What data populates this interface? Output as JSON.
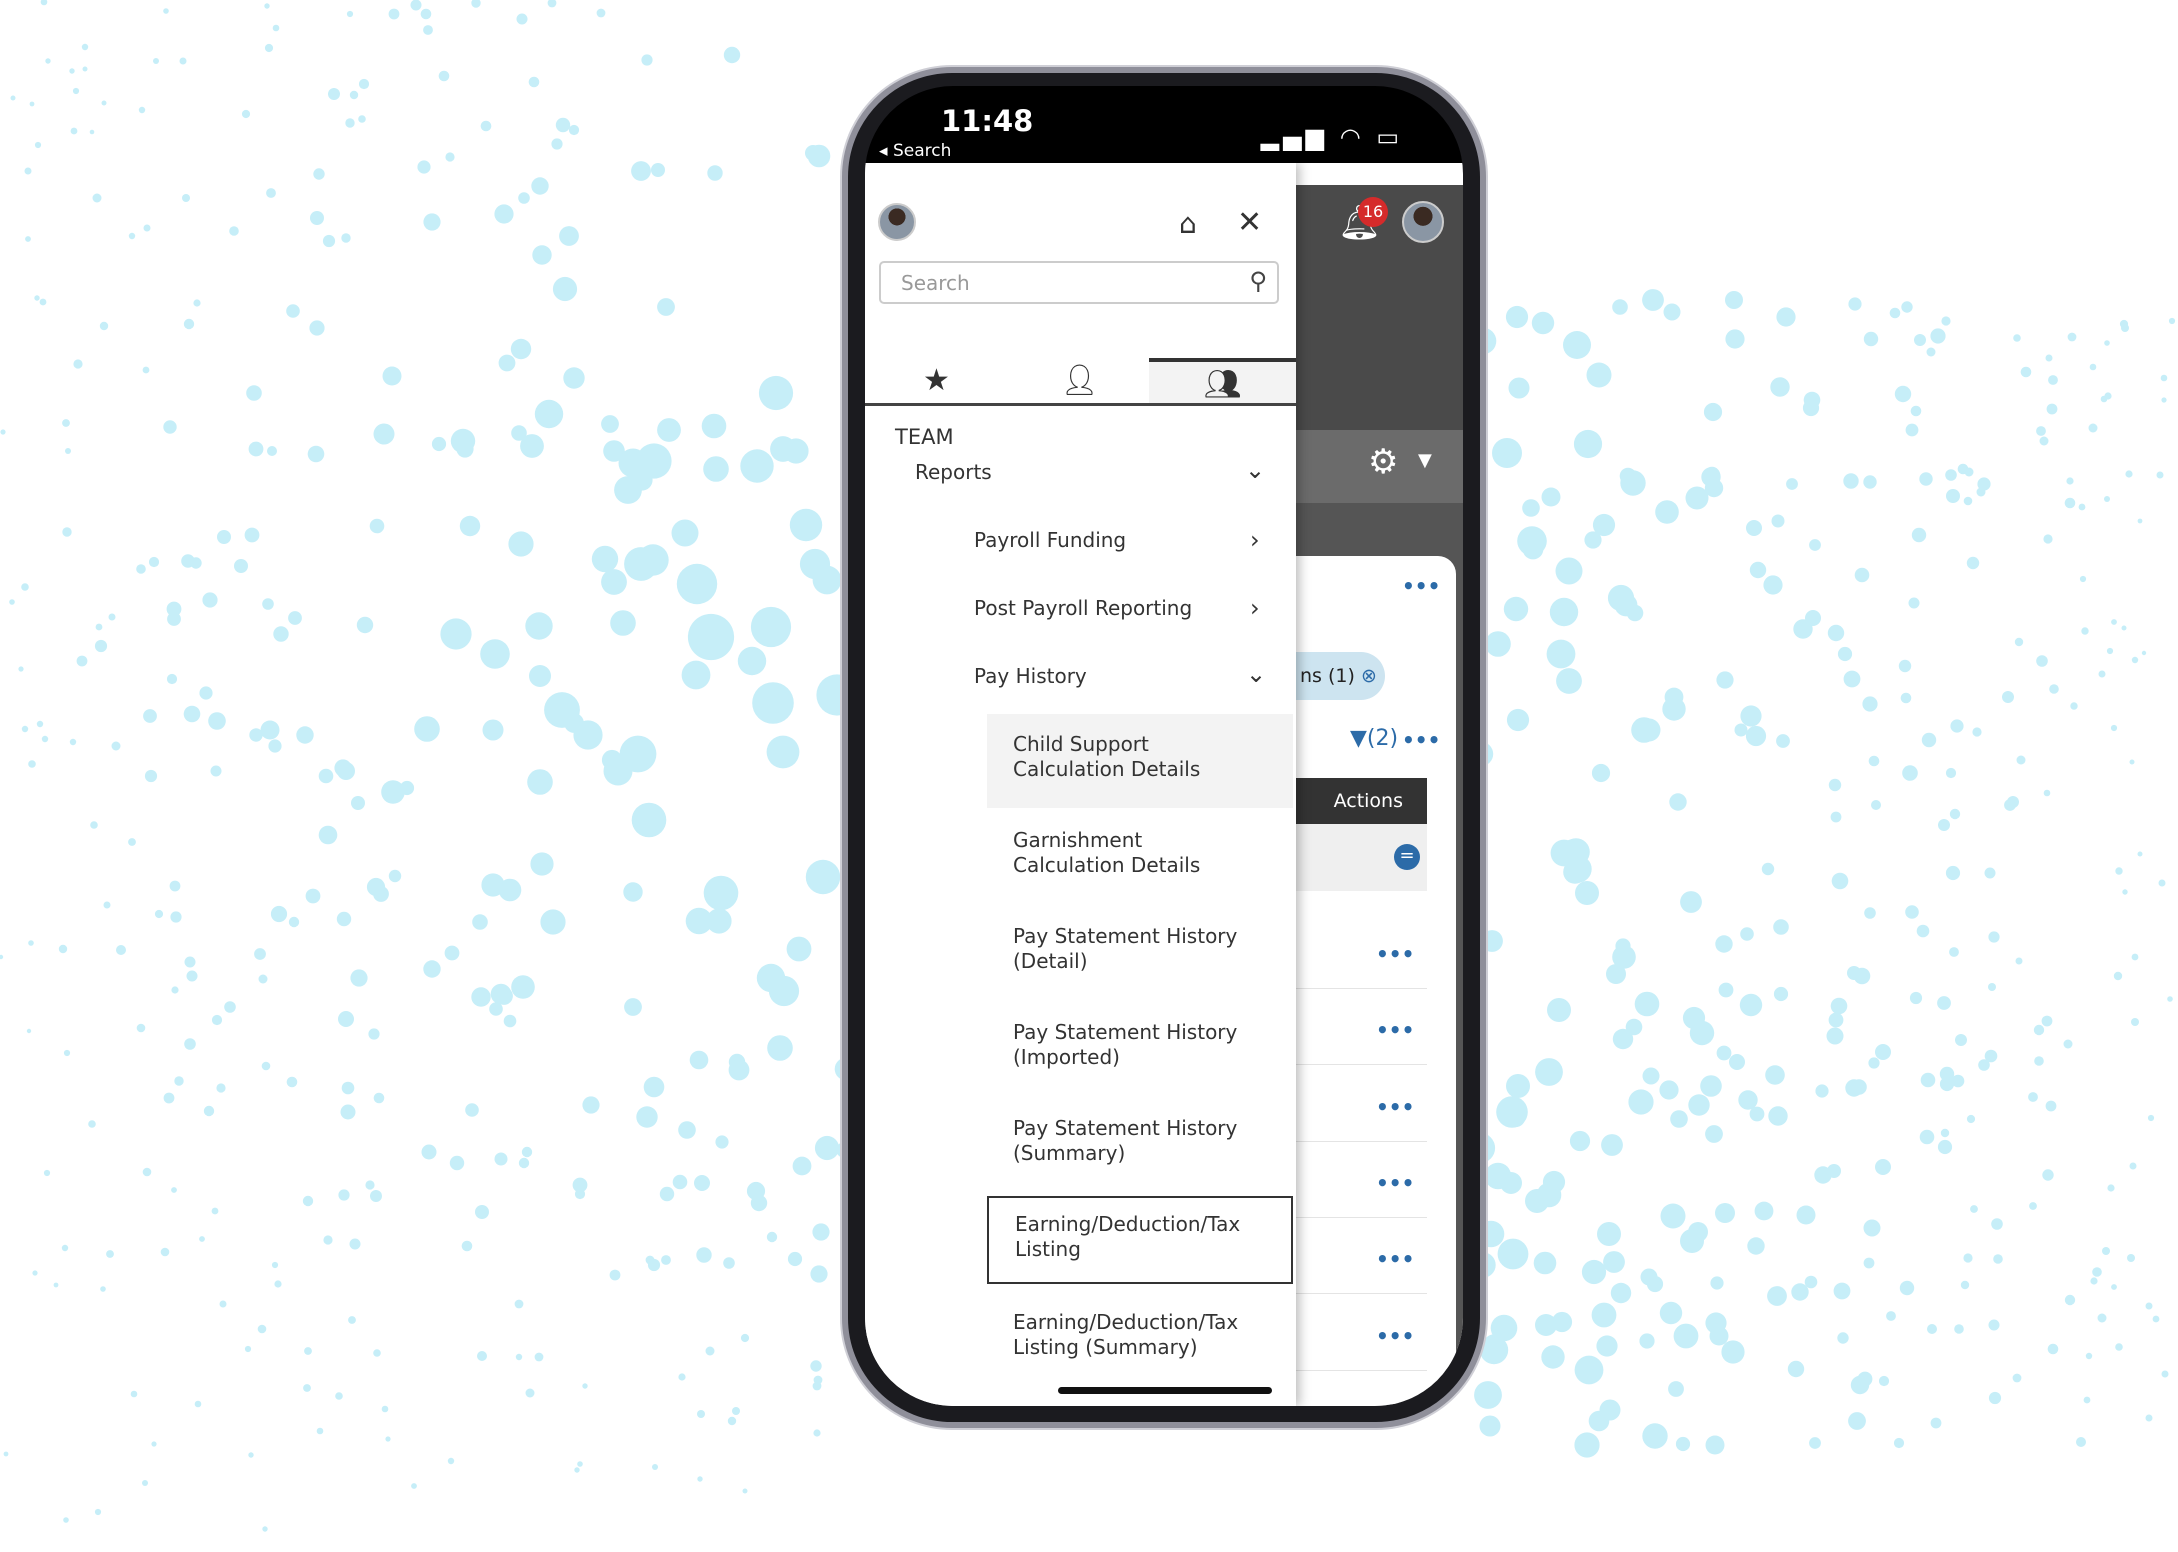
{
  "status_bar": {
    "time": "11:48",
    "back_label": "Search"
  },
  "header": {
    "notification_count": "16"
  },
  "drawer": {
    "search_placeholder": "Search",
    "tabs": [
      {
        "icon": "star-icon"
      },
      {
        "icon": "user-icon"
      },
      {
        "icon": "team-icon",
        "active": true
      }
    ],
    "section": "TEAM",
    "reports": "Reports",
    "items": [
      {
        "label": "Payroll Funding"
      },
      {
        "label": "Post Payroll Reporting"
      },
      {
        "label": "Pay History"
      }
    ],
    "sub_items": [
      {
        "line1": "Child Support",
        "line2": "Calculation Details",
        "state": "hover"
      },
      {
        "line1": "Garnishment",
        "line2": "Calculation Details"
      },
      {
        "line1": "Pay Statement History",
        "line2": "(Detail)"
      },
      {
        "line1": "Pay Statement History",
        "line2": "(Imported)"
      },
      {
        "line1": "Pay Statement History",
        "line2": "(Summary)"
      },
      {
        "line1": "Earning/Deduction/Tax",
        "line2": "Listing",
        "state": "focused"
      },
      {
        "line1": "Earning/Deduction/Tax",
        "line2": "Listing (Summary)"
      }
    ]
  },
  "main": {
    "chip": "ns (1)",
    "filter_count": "(2)",
    "actions_header": "Actions",
    "more": "•••"
  },
  "colors": {
    "accent": "#2c6ba8",
    "badge": "#d52b2b",
    "dots": "#c6eef8"
  }
}
